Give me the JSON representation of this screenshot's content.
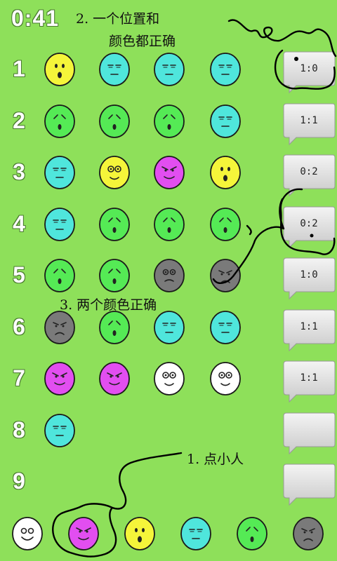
{
  "timer": "0:41",
  "colors": {
    "background": "#8ee05a",
    "yellow": "#f5f53a",
    "cyan": "#4fe6dc",
    "green": "#55ea55",
    "magenta": "#e24ef0",
    "white": "#ffffff",
    "gray": "#7a7a7a"
  },
  "rows": [
    {
      "number": "1",
      "pegs": [
        {
          "color": "yellow",
          "face": "surprised"
        },
        {
          "color": "cyan",
          "face": "sleepy"
        },
        {
          "color": "cyan",
          "face": "sleepy"
        },
        {
          "color": "cyan",
          "face": "sleepy"
        }
      ],
      "score": "1:0"
    },
    {
      "number": "2",
      "pegs": [
        {
          "color": "green",
          "face": "worried"
        },
        {
          "color": "green",
          "face": "worried"
        },
        {
          "color": "green",
          "face": "worried"
        },
        {
          "color": "cyan",
          "face": "sleepy"
        }
      ],
      "score": "1:1"
    },
    {
      "number": "3",
      "pegs": [
        {
          "color": "cyan",
          "face": "sleepy"
        },
        {
          "color": "yellow",
          "face": "goggle"
        },
        {
          "color": "magenta",
          "face": "sly"
        },
        {
          "color": "yellow",
          "face": "surprised"
        }
      ],
      "score": "0:2"
    },
    {
      "number": "4",
      "pegs": [
        {
          "color": "cyan",
          "face": "sleepy"
        },
        {
          "color": "green",
          "face": "worried"
        },
        {
          "color": "green",
          "face": "worried"
        },
        {
          "color": "green",
          "face": "worried"
        }
      ],
      "score": "0:2"
    },
    {
      "number": "5",
      "pegs": [
        {
          "color": "green",
          "face": "worried"
        },
        {
          "color": "green",
          "face": "worried"
        },
        {
          "color": "gray",
          "face": "dizzy"
        },
        {
          "color": "gray",
          "face": "frown"
        }
      ],
      "score": "1:0"
    },
    {
      "number": "6",
      "pegs": [
        {
          "color": "gray",
          "face": "frown"
        },
        {
          "color": "green",
          "face": "worried"
        },
        {
          "color": "cyan",
          "face": "sleepy"
        },
        {
          "color": "cyan",
          "face": "sleepy"
        }
      ],
      "score": "1:1"
    },
    {
      "number": "7",
      "pegs": [
        {
          "color": "magenta",
          "face": "sly"
        },
        {
          "color": "magenta",
          "face": "sly"
        },
        {
          "color": "white",
          "face": "goggle"
        },
        {
          "color": "white",
          "face": "goggle"
        }
      ],
      "score": "1:1"
    },
    {
      "number": "8",
      "pegs": [
        {
          "color": "cyan",
          "face": "sleepy"
        }
      ],
      "score": ""
    },
    {
      "number": "9",
      "pegs": [],
      "score": ""
    }
  ],
  "palette": [
    {
      "color": "white",
      "face": "smile"
    },
    {
      "color": "magenta",
      "face": "sly"
    },
    {
      "color": "yellow",
      "face": "surprised"
    },
    {
      "color": "cyan",
      "face": "sleepy"
    },
    {
      "color": "green",
      "face": "worried"
    },
    {
      "color": "gray",
      "face": "frown"
    }
  ],
  "annotations": {
    "note_click": "1. 点小人",
    "note_position_line1": "2. 一个位置和",
    "note_position_line2": "颜色都正确",
    "note_color": "3. 两个颜色正确"
  },
  "icons": {
    "score_bubble": "speech-bubble-icon",
    "peg": "face-peg-icon"
  }
}
